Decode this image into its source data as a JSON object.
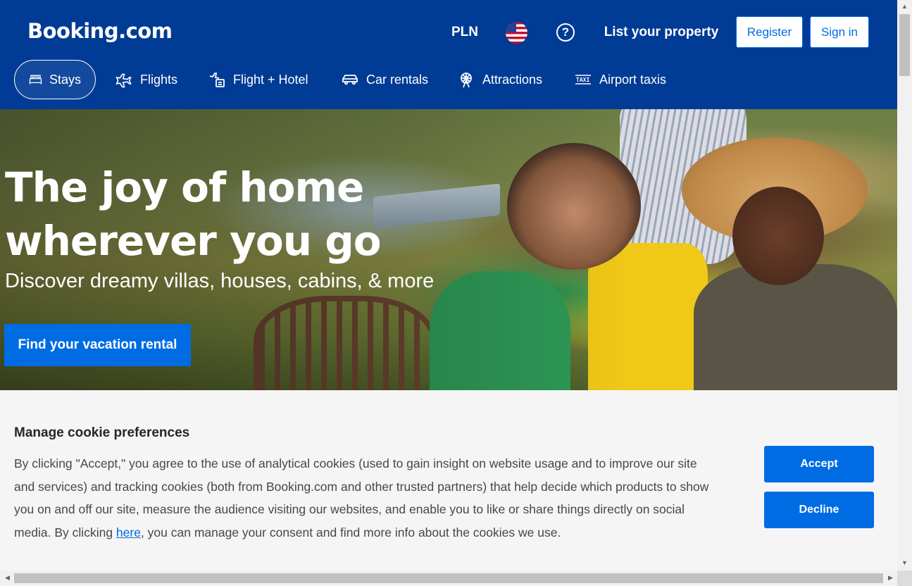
{
  "header": {
    "logo": "Booking.com",
    "currency": "PLN",
    "help_symbol": "?",
    "list_property": "List your property",
    "register": "Register",
    "sign_in": "Sign in"
  },
  "nav": {
    "items": [
      {
        "label": "Stays",
        "icon": "bed-icon",
        "active": true
      },
      {
        "label": "Flights",
        "icon": "airplane-icon"
      },
      {
        "label": "Flight + Hotel",
        "icon": "flight-hotel-icon"
      },
      {
        "label": "Car rentals",
        "icon": "car-icon"
      },
      {
        "label": "Attractions",
        "icon": "ferris-wheel-icon"
      },
      {
        "label": "Airport taxis",
        "icon": "taxi-icon"
      }
    ]
  },
  "hero": {
    "title_line1": "The joy of home",
    "title_line2": "wherever you go",
    "subtitle": "Discover dreamy villas, houses, cabins, & more",
    "cta": "Find your vacation rental"
  },
  "cookie": {
    "title": "Manage cookie preferences",
    "text_before_link": "By clicking \"Accept,\" you agree to the use of analytical cookies (used to gain insight on website usage and to improve our site and services) and tracking cookies (both from Booking.com and other trusted partners) that help decide which products to show you on and off our site, measure the audience visiting our websites, and enable you to like or share things directly on social media. By clicking ",
    "link": "here",
    "text_after_link": ", you can manage your consent and find more info about the cookies we use.",
    "accept": "Accept",
    "decline": "Decline"
  },
  "colors": {
    "brand_blue": "#003b95",
    "action_blue": "#006ce4",
    "cookie_bg": "#f5f5f5"
  }
}
